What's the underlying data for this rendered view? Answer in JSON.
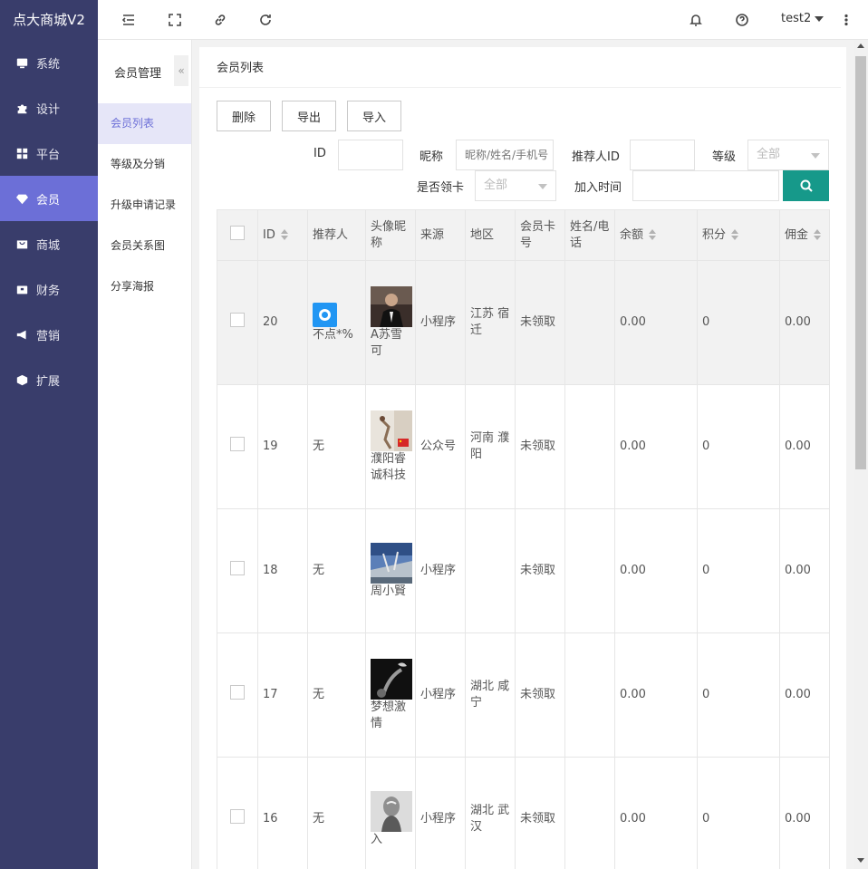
{
  "brand": "点大商城V2",
  "nav": [
    {
      "label": "系统",
      "icon": "monitor-icon",
      "active": false
    },
    {
      "label": "设计",
      "icon": "puzzle-icon",
      "active": false
    },
    {
      "label": "平台",
      "icon": "grid-icon",
      "active": false
    },
    {
      "label": "会员",
      "icon": "diamond-icon",
      "active": true
    },
    {
      "label": "商城",
      "icon": "shop-icon",
      "active": false
    },
    {
      "label": "财务",
      "icon": "wallet-icon",
      "active": false
    },
    {
      "label": "营销",
      "icon": "megaphone-icon",
      "active": false
    },
    {
      "label": "扩展",
      "icon": "cube-icon",
      "active": false
    }
  ],
  "topbar": {
    "user": "test2",
    "icons": [
      "menu-fold-icon",
      "fullscreen-icon",
      "link-icon",
      "refresh-icon",
      "bell-icon",
      "help-icon",
      "more-vertical-icon"
    ]
  },
  "subnav": {
    "title": "会员管理",
    "collapse": "«",
    "items": [
      {
        "label": "会员列表",
        "active": true
      },
      {
        "label": "等级及分销",
        "active": false
      },
      {
        "label": "升级申请记录",
        "active": false
      },
      {
        "label": "会员关系图",
        "active": false
      },
      {
        "label": "分享海报",
        "active": false
      }
    ]
  },
  "main": {
    "title": "会员列表",
    "buttons": {
      "delete": "删除",
      "export": "导出",
      "import": "导入"
    },
    "filters": {
      "id_label": "ID",
      "id_value": "",
      "nickname_label": "昵称",
      "nickname_placeholder": "昵称/姓名/手机号",
      "referrer_label": "推荐人ID",
      "referrer_value": "",
      "level_label": "等级",
      "level_value": "全部",
      "card_label": "是否领卡",
      "card_value": "全部",
      "join_label": "加入时间",
      "join_value": ""
    },
    "columns": [
      "ID",
      "推荐人",
      "头像昵称",
      "来源",
      "地区",
      "会员卡号",
      "姓名/电话",
      "余额",
      "积分",
      "佣金"
    ],
    "rows": [
      {
        "id": "20",
        "referrer": "不点*%",
        "nickname": "A苏雪可",
        "source": "小程序",
        "region": "江苏 宿迁",
        "card": "未领取",
        "contact": "",
        "balance": "0.00",
        "points": "0",
        "commission": "0.00",
        "avatar": "man-in-suit-photo",
        "highlighted": true
      },
      {
        "id": "19",
        "referrer": "无",
        "nickname": "濮阳睿诚科技",
        "source": "公众号",
        "region": "河南 濮阳",
        "card": "未领取",
        "contact": "",
        "balance": "0.00",
        "points": "0",
        "commission": "0.00",
        "avatar": "climber-photo",
        "highlighted": false
      },
      {
        "id": "18",
        "referrer": "无",
        "nickname": "周小賢",
        "source": "小程序",
        "region": "",
        "card": "未领取",
        "contact": "",
        "balance": "0.00",
        "points": "0",
        "commission": "0.00",
        "avatar": "bridge-sky-photo",
        "highlighted": false
      },
      {
        "id": "17",
        "referrer": "无",
        "nickname": "梦想激情",
        "source": "小程序",
        "region": "湖北 咸宁",
        "card": "未领取",
        "contact": "",
        "balance": "0.00",
        "points": "0",
        "commission": "0.00",
        "avatar": "dark-smoke-photo",
        "highlighted": false
      },
      {
        "id": "16",
        "referrer": "无",
        "nickname": "入",
        "source": "小程序",
        "region": "湖北 武汉",
        "card": "未领取",
        "contact": "",
        "balance": "0.00",
        "points": "0",
        "commission": "0.00",
        "avatar": "grey-figure-photo",
        "highlighted": false
      }
    ]
  },
  "colors": {
    "nav_bg": "#393d6b",
    "nav_active": "#6c6fd7",
    "accent": "#16998a"
  }
}
